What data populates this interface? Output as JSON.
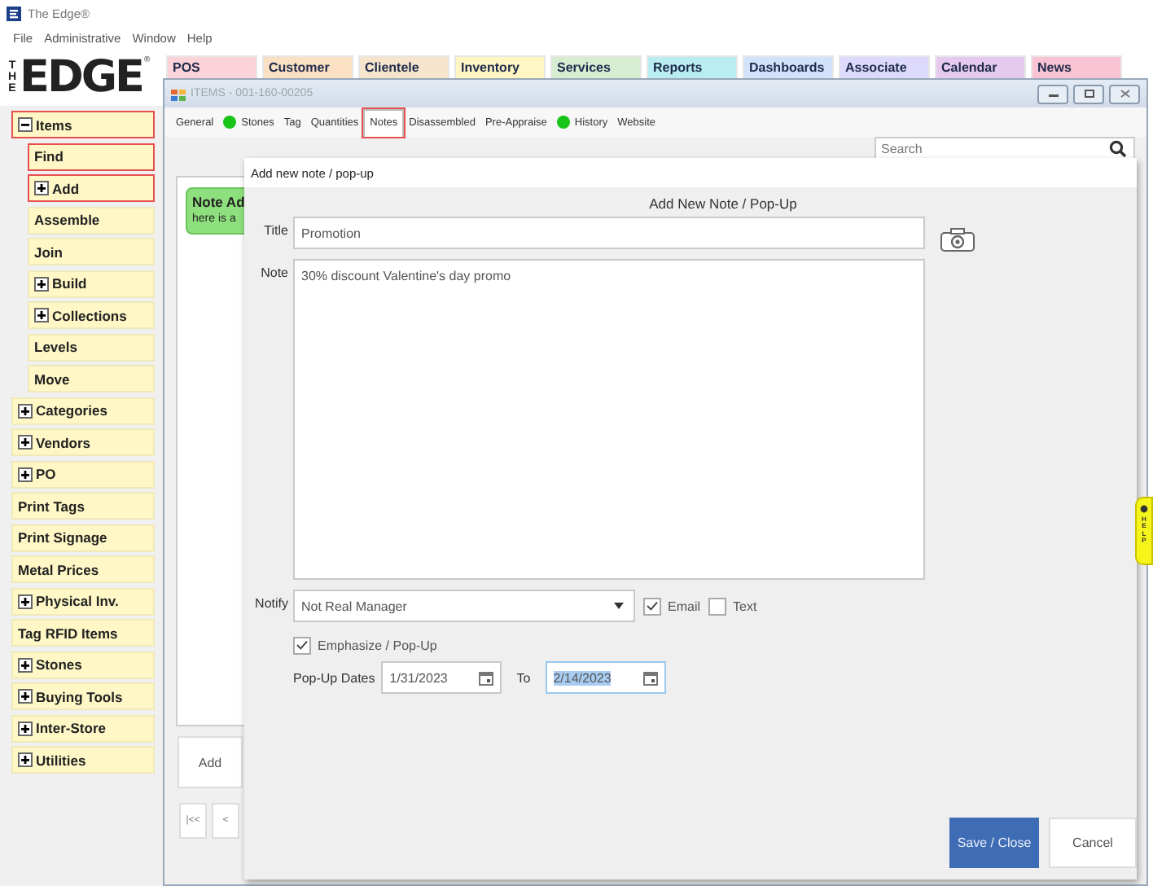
{
  "app": {
    "title": "The Edge®"
  },
  "menu": [
    "File",
    "Administrative",
    "Window",
    "Help"
  ],
  "logo": {
    "side": "THE",
    "word": "EDGE",
    "mark": "®"
  },
  "nav_tabs": [
    {
      "label": "POS",
      "color": "#fdd3da"
    },
    {
      "label": "Customer",
      "color": "#fce0c4"
    },
    {
      "label": "Clientele",
      "color": "#f6e4cc"
    },
    {
      "label": "Inventory",
      "color": "#fff6c4"
    },
    {
      "label": "Services",
      "color": "#d6edd2"
    },
    {
      "label": "Reports",
      "color": "#b9edf2"
    },
    {
      "label": "Dashboards",
      "color": "#d2e2fb"
    },
    {
      "label": "Associate",
      "color": "#ddd9fc"
    },
    {
      "label": "Calendar",
      "color": "#e6c9ee"
    },
    {
      "label": "News",
      "color": "#f9c3d3"
    }
  ],
  "sidebar": {
    "items": [
      {
        "label": "Items",
        "expanded": true,
        "highlighted": true,
        "children": [
          {
            "label": "Find",
            "highlighted": true
          },
          {
            "label": "Add",
            "expanded": false,
            "highlighted": true
          },
          {
            "label": "Assemble",
            "highlighted": false
          },
          {
            "label": "Join",
            "highlighted": false
          },
          {
            "label": "Build",
            "expanded": false,
            "highlighted": false
          },
          {
            "label": "Collections",
            "expanded": false,
            "highlighted": false
          },
          {
            "label": "Levels",
            "highlighted": false
          },
          {
            "label": "Move",
            "highlighted": false
          }
        ]
      },
      {
        "label": "Categories",
        "expanded": false,
        "highlighted": false
      },
      {
        "label": "Vendors",
        "expanded": false,
        "highlighted": false
      },
      {
        "label": "PO",
        "expanded": false,
        "highlighted": false
      },
      {
        "label": "Print Tags",
        "highlighted": false
      },
      {
        "label": "Print Signage",
        "highlighted": false
      },
      {
        "label": "Metal Prices",
        "highlighted": false
      },
      {
        "label": "Physical Inv.",
        "expanded": false,
        "highlighted": false
      },
      {
        "label": "Tag RFID Items",
        "highlighted": false
      },
      {
        "label": "Stones",
        "expanded": false,
        "highlighted": false
      },
      {
        "label": "Buying Tools",
        "expanded": false,
        "highlighted": false
      },
      {
        "label": "Inter-Store",
        "expanded": false,
        "highlighted": false
      },
      {
        "label": "Utilities",
        "expanded": false,
        "highlighted": false
      }
    ]
  },
  "items_window": {
    "title": "ITEMS - 001-160-00205",
    "tabs": [
      {
        "label": "General",
        "selected": false,
        "dot": false,
        "highlighted": false
      },
      {
        "label": "Stones",
        "selected": false,
        "dot": true,
        "highlighted": false
      },
      {
        "label": "Tag",
        "selected": false,
        "dot": false,
        "highlighted": false
      },
      {
        "label": "Quantities",
        "selected": false,
        "dot": false,
        "highlighted": false
      },
      {
        "label": "Notes",
        "selected": true,
        "dot": false,
        "highlighted": true
      },
      {
        "label": "Disassembled",
        "selected": false,
        "dot": false,
        "highlighted": false
      },
      {
        "label": "Pre-Appraise",
        "selected": false,
        "dot": false,
        "highlighted": false
      },
      {
        "label": "History",
        "selected": false,
        "dot": true,
        "highlighted": false
      },
      {
        "label": "Website",
        "selected": false,
        "dot": false,
        "highlighted": false
      }
    ],
    "search": {
      "placeholder": "Search"
    },
    "note_card": {
      "title": "Note Ad",
      "text": "here is a"
    },
    "add_button": "Add",
    "pager": [
      "|<<",
      "<"
    ]
  },
  "dialog": {
    "title": "Add new note / pop-up",
    "heading": "Add New Note / Pop-Up",
    "title_label": "Title",
    "title_value": "Promotion",
    "note_label": "Note",
    "note_value": "30% discount Valentine's day promo",
    "notify_label": "Notify",
    "notify_value": "Not Real Manager",
    "options": [
      {
        "label": "Email",
        "checked": true
      },
      {
        "label": "Text",
        "checked": false
      }
    ],
    "emphasize": {
      "label": "Emphasize / Pop-Up",
      "checked": true
    },
    "dates_label": "Pop-Up Dates",
    "date_from": "1/31/2023",
    "to_label": "To",
    "date_to": {
      "value": "2/14/2023",
      "selected": true
    },
    "buttons": [
      {
        "label": "Save / Close",
        "kind": "primary"
      },
      {
        "label": "Cancel",
        "kind": "secondary"
      }
    ]
  },
  "help_tab": {
    "label": "HELP"
  }
}
